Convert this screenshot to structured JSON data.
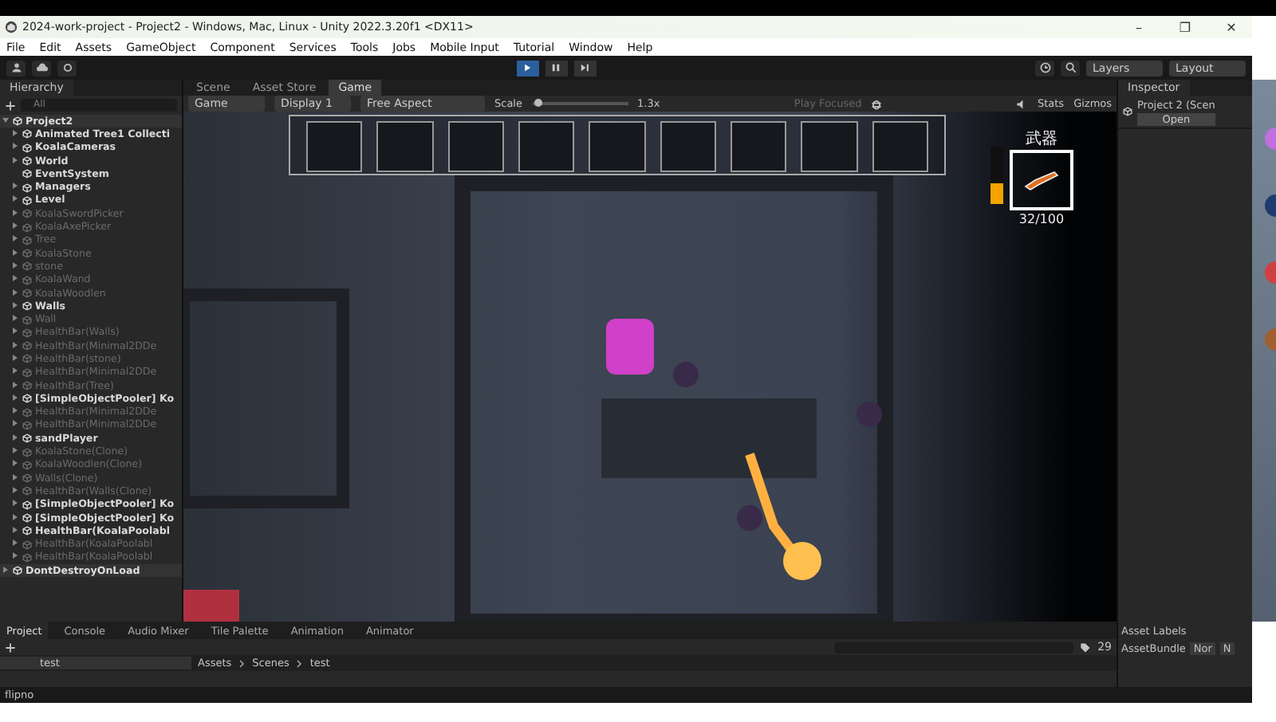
{
  "window": {
    "title": "2024-work-project - Project2 - Windows, Mac, Linux - Unity 2022.3.20f1 <DX11>",
    "controls": [
      "–",
      "❐",
      "✕"
    ]
  },
  "menu": [
    "File",
    "Edit",
    "Assets",
    "GameObject",
    "Component",
    "Services",
    "Tools",
    "Jobs",
    "Mobile Input",
    "Tutorial",
    "Window",
    "Help"
  ],
  "toolbar": {
    "play_buttons": [
      {
        "kind": "play",
        "selected": true
      },
      {
        "kind": "pause",
        "selected": false
      },
      {
        "kind": "step",
        "selected": false
      }
    ],
    "layers": "Layers",
    "layout": "Layout"
  },
  "hierarchy": {
    "title": "Hierarchy",
    "search_placeholder": "All",
    "scenes": [
      {
        "name": "Project2",
        "children": [
          {
            "name": "Animated Tree1 Collecti",
            "active": true,
            "expandable": true
          },
          {
            "name": "KoalaCameras",
            "active": true,
            "expandable": true
          },
          {
            "name": "World",
            "active": true,
            "expandable": true
          },
          {
            "name": "EventSystem",
            "active": true,
            "expandable": false
          },
          {
            "name": "Managers",
            "active": true,
            "expandable": true
          },
          {
            "name": "Level",
            "active": true,
            "expandable": true
          },
          {
            "name": "KoalaSwordPicker",
            "active": false,
            "expandable": true
          },
          {
            "name": "KoalaAxePicker",
            "active": false,
            "expandable": true
          },
          {
            "name": "Tree",
            "active": false,
            "expandable": true
          },
          {
            "name": "KoalaStone",
            "active": false,
            "expandable": true
          },
          {
            "name": "stone",
            "active": false,
            "expandable": true
          },
          {
            "name": "KoalaWand",
            "active": false,
            "expandable": true
          },
          {
            "name": "KoalaWoodlen",
            "active": false,
            "expandable": true
          },
          {
            "name": "Walls",
            "active": true,
            "expandable": true
          },
          {
            "name": "Wall",
            "active": false,
            "expandable": true
          },
          {
            "name": "HealthBar(Walls)",
            "active": false,
            "expandable": true
          },
          {
            "name": "HealthBar(Minimal2DDe",
            "active": false,
            "expandable": true
          },
          {
            "name": "HealthBar(stone)",
            "active": false,
            "expandable": true
          },
          {
            "name": "HealthBar(Minimal2DDe",
            "active": false,
            "expandable": true
          },
          {
            "name": "HealthBar(Tree)",
            "active": false,
            "expandable": true
          },
          {
            "name": "[SimpleObjectPooler] Ko",
            "active": true,
            "expandable": true
          },
          {
            "name": "HealthBar(Minimal2DDe",
            "active": false,
            "expandable": true
          },
          {
            "name": "HealthBar(Minimal2DDe",
            "active": false,
            "expandable": true
          },
          {
            "name": "sandPlayer",
            "active": true,
            "expandable": true
          },
          {
            "name": "KoalaStone(Clone)",
            "active": false,
            "expandable": true
          },
          {
            "name": "KoalaWoodlen(Clone)",
            "active": false,
            "expandable": true
          },
          {
            "name": "Walls(Clone)",
            "active": false,
            "expandable": true
          },
          {
            "name": "HealthBar(Walls(Clone)",
            "active": false,
            "expandable": true
          },
          {
            "name": "[SimpleObjectPooler] Ko",
            "active": true,
            "expandable": true
          },
          {
            "name": "[SimpleObjectPooler] Ko",
            "active": true,
            "expandable": true
          },
          {
            "name": "HealthBar(KoalaPoolabl",
            "active": true,
            "expandable": true
          },
          {
            "name": "HealthBar(KoalaPoolabl",
            "active": false,
            "expandable": true
          },
          {
            "name": "HealthBar(KoalaPoolabl",
            "active": false,
            "expandable": true
          }
        ]
      },
      {
        "name": "DontDestroyOnLoad"
      }
    ]
  },
  "view_tabs": [
    {
      "label": "Scene",
      "selected": false
    },
    {
      "label": "Asset Store",
      "selected": false
    },
    {
      "label": "Game",
      "selected": true
    }
  ],
  "game_toolbar": {
    "mode": "Game",
    "display": "Display 1",
    "aspect": "Free Aspect",
    "scale_label": "Scale",
    "scale": {
      "level": 0.05
    },
    "scale_value": "1.3x",
    "play_focused": "Play Focused",
    "stats": "Stats",
    "gizmos": "Gizmos"
  },
  "hud": {
    "weapon_label": "武器",
    "ammo": "32/100",
    "energy": {
      "level": 0.35
    }
  },
  "inspector": {
    "title": "Inspector",
    "object": "Project 2 (Scen",
    "open": "Open",
    "asset_labels": "Asset Labels",
    "asset_bundle": "AssetBundle",
    "bundle_value": "Nor",
    "variant_value": "N"
  },
  "bottom_tabs": [
    {
      "label": "Project",
      "selected": true
    },
    {
      "label": "Console",
      "selected": false
    },
    {
      "label": "Audio Mixer",
      "selected": false
    },
    {
      "label": "Tile Palette",
      "selected": false
    },
    {
      "label": "Animation",
      "selected": false
    },
    {
      "label": "Animator",
      "selected": false
    }
  ],
  "project": {
    "folder": "test",
    "breadcrumb": [
      "Assets",
      "Scenes",
      "test"
    ],
    "hidden_count": "29"
  },
  "status_bar": {
    "message": "flipno"
  }
}
